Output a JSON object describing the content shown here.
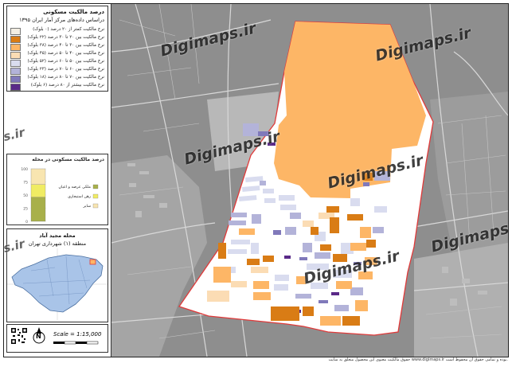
{
  "legend": {
    "title_line1": "درصد مالکیت مسکونی",
    "title_line2": "دراساس داده‌های مرکز آمار ایران ۱۳۹۵",
    "classes": [
      {
        "label": "نرخ مالکیت کمتر از ۲۰ درصد (۰ بلوک)",
        "color": "#f3eee2"
      },
      {
        "label": "نرخ مالکیت بین ۲۰ تا ۳۰ درصد (۲۲ بلوک)",
        "color": "#d97c15"
      },
      {
        "label": "نرخ مالکیت بین ۳۰ تا ۴۰ درصد (۳۸ بلوک)",
        "color": "#fdb666"
      },
      {
        "label": "نرخ مالکیت بین ۴۰ تا ۵۰ درصد (۴۵ بلوک)",
        "color": "#fbdcb4"
      },
      {
        "label": "نرخ مالکیت بین ۵۰ تا ۶۰ درصد (۵۲ بلوک)",
        "color": "#d9dcef"
      },
      {
        "label": "نرخ مالکیت بین ۶۰ تا ۷۰ درصد (۲۳ بلوک)",
        "color": "#b3b3d9"
      },
      {
        "label": "نرخ مالکیت بین ۷۰ تا ۸۰ درصد (۱۸ بلوک)",
        "color": "#8079ba"
      },
      {
        "label": "نرخ مالکیت بیشتر از ۸۰ درصد (۶ بلوک)",
        "color": "#5a2a88"
      }
    ]
  },
  "chart": {
    "title": "درصد مالکیت مسکونی در محله",
    "tick_labels": [
      "100",
      "75",
      "50",
      "25",
      "0"
    ],
    "segments": [
      {
        "label": "ملکی عرصه و اعیان",
        "color": "#a8b04a",
        "value": 46
      },
      {
        "label": "رهن استیجاری",
        "color": "#f0ec63",
        "value": 24
      },
      {
        "label": "سایر",
        "color": "#f8e5b0",
        "value": 30
      }
    ]
  },
  "locator": {
    "neighborhood": "محله مجید آباد",
    "district": "منطقه (۱) شهرداری تهران"
  },
  "scale": {
    "text": "Scale = 1:15,000",
    "north": "N"
  },
  "footer": "حقوق مالکیت معنوی این محصول متعلق به سایت www.digimaps.ir بوده و تمامی حقوق آن محفوظ است.",
  "watermarks": [
    "Digimaps.ir",
    "Digimaps.ir",
    "Digimaps.ir",
    "Digimaps.ir",
    "Digimaps.ir",
    "Digimaps.ir",
    "s.ir",
    "s.ir"
  ],
  "colors": {
    "boundary": "#e03a3a",
    "background_map": "#8f8f8f",
    "large_block": "#fdb666"
  }
}
